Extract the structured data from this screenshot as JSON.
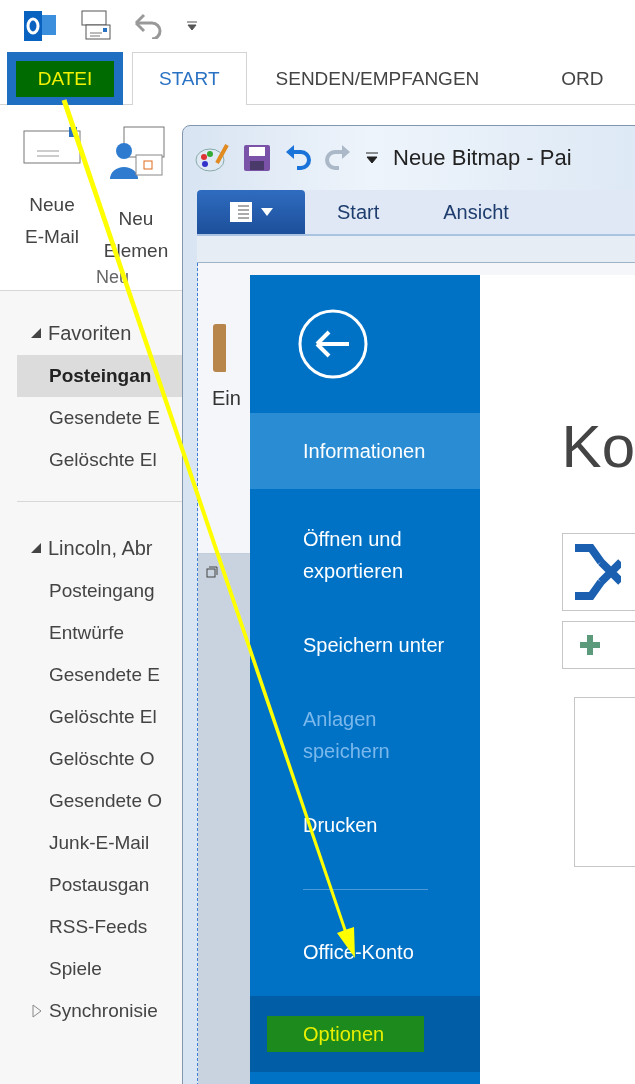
{
  "outlook": {
    "tabs": [
      {
        "label": "DATEI",
        "kind": "file",
        "selected": false,
        "highlighted": true
      },
      {
        "label": "START",
        "kind": "tab",
        "selected": true,
        "highlighted": false
      },
      {
        "label": "SENDEN/EMPFANGEN",
        "kind": "tab",
        "selected": false,
        "highlighted": false
      },
      {
        "label": "ORD",
        "kind": "tab",
        "selected": false,
        "highlighted": false
      }
    ],
    "ribbon": {
      "buttons": [
        {
          "kind": "mail",
          "lines": [
            "Neue",
            "E-Mail"
          ]
        },
        {
          "kind": "items",
          "lines": [
            "Neu",
            "Elemen"
          ]
        }
      ],
      "group_label": "Neu"
    },
    "folders": [
      {
        "label": "Favoriten",
        "kind": "header",
        "expanded": true,
        "children": [
          {
            "label": "Posteingan",
            "selected": true
          },
          {
            "label": "Gesendete E",
            "selected": false
          },
          {
            "label": "Gelöschte El",
            "selected": false
          }
        ]
      },
      {
        "label": "Lincoln, Abr",
        "kind": "header",
        "expanded": true,
        "children": [
          {
            "label": "Posteingang",
            "selected": false
          },
          {
            "label": "Entwürfe",
            "selected": false
          },
          {
            "label": "Gesendete E",
            "selected": false
          },
          {
            "label": "Gelöschte El",
            "selected": false
          },
          {
            "label": "Gelöschte O",
            "selected": false
          },
          {
            "label": "Gesendete O",
            "selected": false
          },
          {
            "label": "Junk-E-Mail",
            "selected": false
          },
          {
            "label": "Postausgan",
            "selected": false
          },
          {
            "label": "RSS-Feeds",
            "selected": false
          },
          {
            "label": "Spiele",
            "selected": false
          },
          {
            "label": "Synchronisie",
            "selected": false,
            "expanded": false
          }
        ]
      }
    ]
  },
  "paint": {
    "title": "Neue Bitmap - Pai",
    "tabs": [
      {
        "label": "Start",
        "selected": false
      },
      {
        "label": "Ansicht",
        "selected": false
      }
    ],
    "ribbon_label": "Ein"
  },
  "backstage": {
    "menu": [
      {
        "kind": "item",
        "label": "Informationen",
        "selected": true,
        "disabled": false,
        "hovered": false,
        "highlighted": false
      },
      {
        "kind": "item",
        "label": "Öffnen und\nexportieren",
        "selected": false,
        "disabled": false,
        "hovered": false,
        "highlighted": false
      },
      {
        "kind": "item",
        "label": "Speichern unter",
        "selected": false,
        "disabled": false,
        "hovered": false,
        "highlighted": false
      },
      {
        "kind": "item",
        "label": "Anlagen\nspeichern",
        "selected": false,
        "disabled": true,
        "hovered": false,
        "highlighted": false
      },
      {
        "kind": "item",
        "label": "Drucken",
        "selected": false,
        "disabled": false,
        "hovered": false,
        "highlighted": false
      },
      {
        "kind": "separator"
      },
      {
        "kind": "item",
        "label": "Office-Konto",
        "selected": false,
        "disabled": false,
        "hovered": false,
        "highlighted": false
      },
      {
        "kind": "item",
        "label": "Optionen",
        "selected": false,
        "disabled": false,
        "hovered": true,
        "highlighted": true
      }
    ],
    "heading": "Ko"
  }
}
